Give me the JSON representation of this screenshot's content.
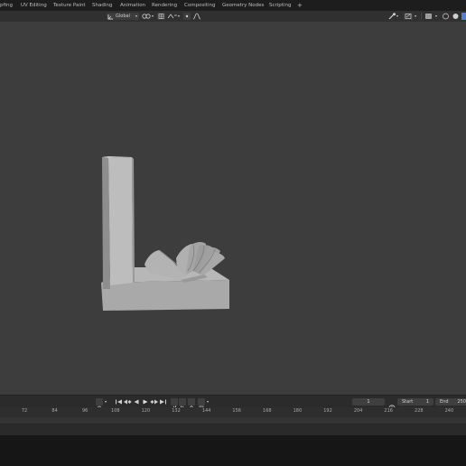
{
  "workspaces": [
    {
      "key": "modeling",
      "label": "pfing"
    },
    {
      "key": "uv",
      "label": "UV Editing"
    },
    {
      "key": "texture",
      "label": "Texture Paint"
    },
    {
      "key": "shading",
      "label": "Shading"
    },
    {
      "key": "animation",
      "label": "Animation"
    },
    {
      "key": "rendering",
      "label": "Rendering"
    },
    {
      "key": "compositing",
      "label": "Compositing"
    },
    {
      "key": "geometry",
      "label": "Geometry Nodes"
    },
    {
      "key": "scripting",
      "label": "Scripting"
    },
    {
      "key": "add",
      "label": "+"
    }
  ],
  "viewport_header": {
    "orientation_label": "Global"
  },
  "timeline": {
    "current_frame": "1",
    "start_label": "Start",
    "start_value": "1",
    "end_label": "End",
    "end_value": "250",
    "ruler_ticks": [
      "72",
      "84",
      "96",
      "108",
      "120",
      "132",
      "144",
      "156",
      "168",
      "180",
      "192",
      "204",
      "216",
      "228",
      "240"
    ]
  },
  "colors": {
    "viewport_bg": "#3d3d3d",
    "model_light": "#b9b9b9",
    "model_mid": "#a3a3a3",
    "model_dark": "#8c8c8c",
    "ui_dark": "#1d1d1d"
  }
}
